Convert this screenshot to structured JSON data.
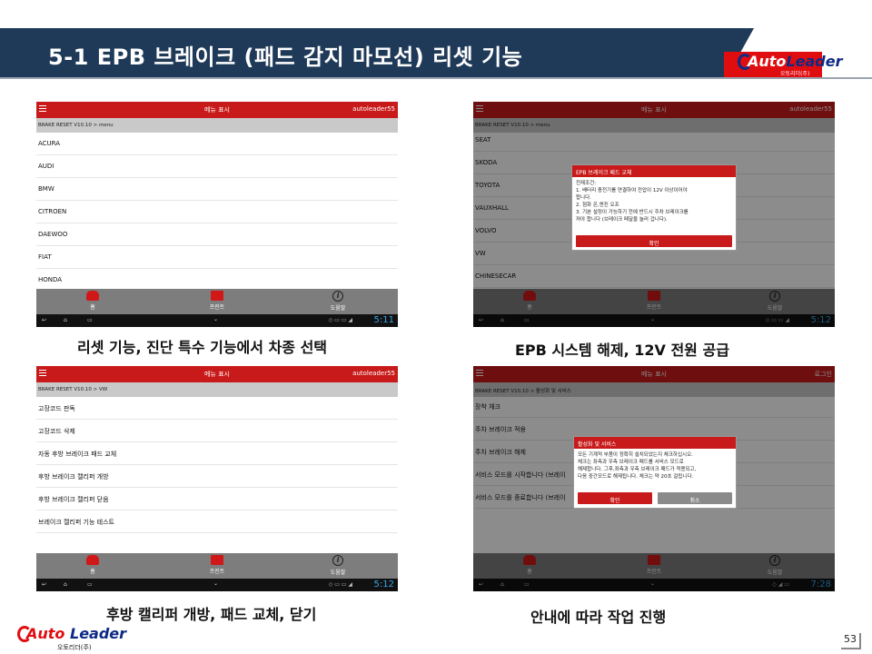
{
  "title": "5-1 EPB 브레이크 (패드 감지 마모선) 리셋 기능",
  "brand": {
    "name_a": "Auto",
    "name_b": "Leader",
    "sub": "오토리더(주)"
  },
  "page_number": "53",
  "captions": {
    "c1": "리셋 기능, 진단 특수 기능에서 차종 선택",
    "c2": "EPB 시스템 해제, 12V 전원 공급",
    "c3": "후방 캘리퍼 개방, 패드 교체, 닫기",
    "c4": "안내에 따라 작업 진행"
  },
  "app": {
    "title": "메뉴 표시",
    "account": "autoleader55",
    "login": "로그인",
    "nav": {
      "home": "홈",
      "print": "프린트",
      "help": "도움말"
    }
  },
  "screen1": {
    "crumb": "BRAKE RESET V10.10 > menu",
    "time": "5:11",
    "items": [
      "ACURA",
      "AUDI",
      "BMW",
      "CITROEN",
      "DAEWOO",
      "FIAT",
      "HONDA"
    ]
  },
  "screen2": {
    "crumb": "BRAKE RESET V10.10 > menu",
    "time": "5:12",
    "items": [
      "SEAT",
      "SKODA",
      "TOYOTA",
      "VAUXHALL",
      "VOLVO",
      "VW",
      "CHINESECAR"
    ],
    "dialog": {
      "title": "EPB 브레이크 패드 교체",
      "l1": "전제조건:",
      "l2": "1. 배터리 충전기를 연결하여 전압이 12V 이상이어야",
      "l3": "합니다.",
      "l4": "2. 점화 온,엔진 오프",
      "l5": "3. 기본 설정이 가능하기 전에 반드시 주차 브레이크를",
      "l6": "꺼야 합니다 (브레이크 페달을 놀러 겁니다).",
      "ok": "확인"
    }
  },
  "screen3": {
    "crumb": "BRAKE RESET V10.10 > VW",
    "time": "5:12",
    "items": [
      "고장코드 판독",
      "고장코드 삭제",
      "자동 후방 브레이크 패드 교체",
      "후방 브레이크 캘리퍼 개방",
      "후방 브레이크 캘리퍼 닫음",
      "브레이크 캘리퍼 기능 테스트"
    ]
  },
  "screen4": {
    "crumb": "BRAKE RESET V10.10 > 활성화 및 서비스",
    "time": "7:28",
    "items": [
      "장착 체크",
      "주차 브레이크 적용",
      "주차 브레이크 해제",
      "서비스 모드를 시작합니다 (브레이",
      "서비스 모드를 종료합니다 (브레이"
    ],
    "dialog": {
      "title": "활성화 및 서비스",
      "l1": "모든 기계적 부품이 정확히 설치되었는지 체크하십시오.",
      "l2": "체크는 좌측과 우측 브레이크 패드를 서비스 모드로",
      "l3": "해제합니다. 그후,좌측과 우측 브레이크 패드가 적용되고,",
      "l4": "다음 중간모드로 해제됩니다. 체크는 약 20초 걸립니다.",
      "ok": "확인",
      "cancel": "취소"
    }
  }
}
